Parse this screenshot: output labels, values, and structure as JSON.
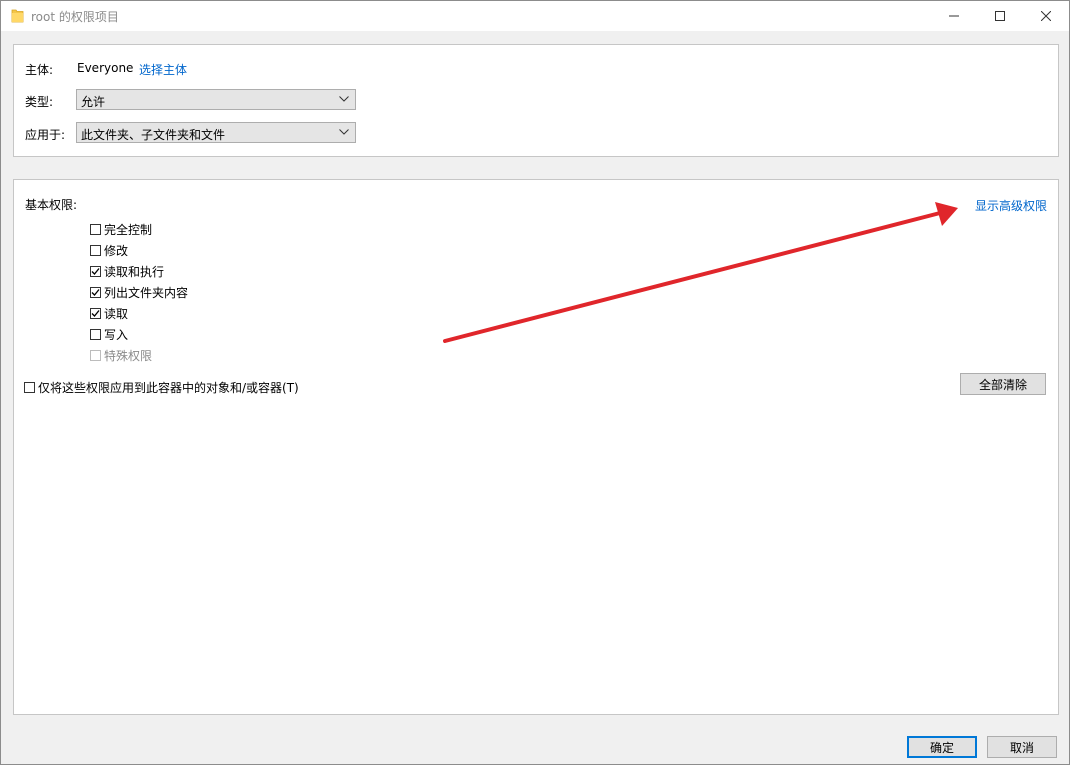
{
  "window": {
    "title": "root 的权限项目"
  },
  "principal": {
    "label": "主体:",
    "value": "Everyone",
    "select_link": "选择主体"
  },
  "type": {
    "label": "类型:",
    "value": "允许"
  },
  "applies_to": {
    "label": "应用于:",
    "value": "此文件夹、子文件夹和文件"
  },
  "basic_permissions": {
    "label": "基本权限:",
    "show_advanced_link": "显示高级权限",
    "items": [
      {
        "label": "完全控制",
        "checked": false,
        "enabled": true
      },
      {
        "label": "修改",
        "checked": false,
        "enabled": true
      },
      {
        "label": "读取和执行",
        "checked": true,
        "enabled": true
      },
      {
        "label": "列出文件夹内容",
        "checked": true,
        "enabled": true
      },
      {
        "label": "读取",
        "checked": true,
        "enabled": true
      },
      {
        "label": "写入",
        "checked": false,
        "enabled": true
      },
      {
        "label": "特殊权限",
        "checked": false,
        "enabled": false
      }
    ]
  },
  "apply_only_container": {
    "label": "仅将这些权限应用到此容器中的对象和/或容器(T)",
    "checked": false
  },
  "clear_all_label": "全部清除",
  "footer": {
    "ok_label": "确定",
    "cancel_label": "取消"
  },
  "colors": {
    "link": "#0066cc",
    "annotation_arrow": "#e0262b",
    "default_button_border": "#0078d7"
  }
}
